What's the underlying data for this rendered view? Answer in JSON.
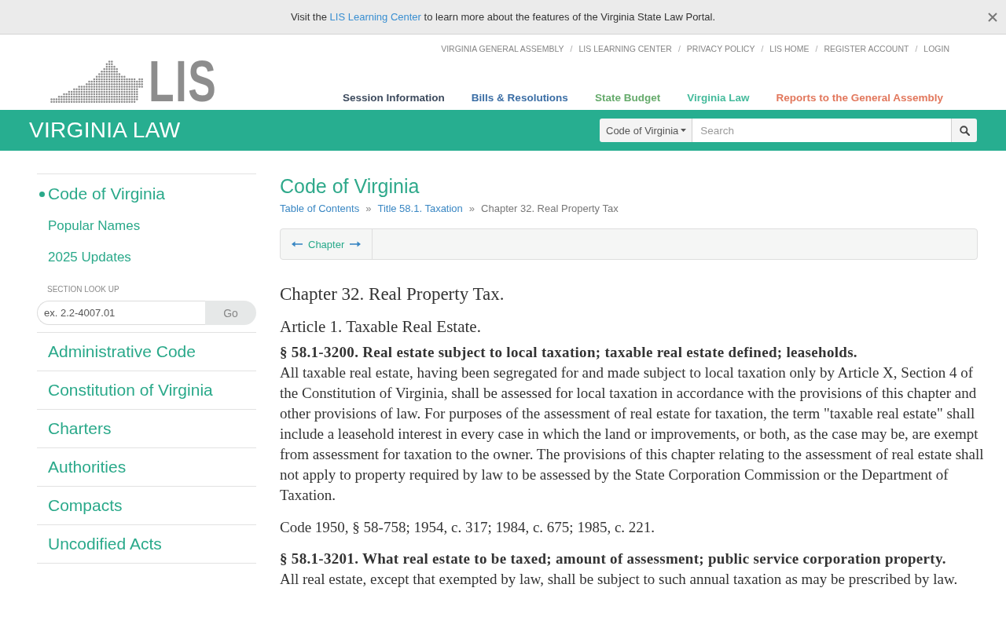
{
  "banner": {
    "text_before": "Visit the",
    "link": "LIS Learning Center",
    "text_after": "to learn more about the features of the Virginia State Law Portal."
  },
  "header": {
    "logo_text": "LIS",
    "top_links": [
      {
        "kind": "link",
        "label": "VIRGINIA GENERAL ASSEMBLY"
      },
      {
        "kind": "separator",
        "label": "/"
      },
      {
        "kind": "link",
        "label": "LIS LEARNING CENTER"
      },
      {
        "kind": "separator",
        "label": "/"
      },
      {
        "kind": "link",
        "label": "PRIVACY POLICY"
      },
      {
        "kind": "separator",
        "label": "/"
      },
      {
        "kind": "link",
        "label": "LIS HOME"
      },
      {
        "kind": "separator",
        "label": "/"
      },
      {
        "kind": "link",
        "label": "REGISTER ACCOUNT"
      },
      {
        "kind": "separator",
        "label": "/"
      },
      {
        "kind": "link",
        "label": "LOGIN"
      }
    ],
    "nav": [
      {
        "label": "Session Information",
        "color": "#3d4b5e"
      },
      {
        "label": "Bills & Resolutions",
        "color": "#3b6ea5"
      },
      {
        "label": "State Budget",
        "color": "#66ab6c"
      },
      {
        "label": "Virginia Law",
        "color": "#45bb9c"
      },
      {
        "label": "Reports to the General Assembly",
        "color": "#e2785d"
      }
    ]
  },
  "law_bar": {
    "title": "VIRGINIA LAW",
    "search": {
      "scope": "Code of Virginia",
      "placeholder": "Search"
    }
  },
  "sidebar": {
    "items": [
      {
        "label": "Code of Virginia",
        "selected": true
      },
      {
        "label": "Popular Names",
        "selected": false
      },
      {
        "label": "2025 Updates",
        "selected": false
      }
    ],
    "lookup": {
      "label": "SECTION LOOK UP",
      "placeholder": "ex. 2.2-4007.01",
      "button": "Go"
    },
    "collections": [
      "Administrative Code",
      "Constitution of Virginia",
      "Charters",
      "Authorities",
      "Compacts",
      "Uncodified Acts"
    ]
  },
  "content": {
    "title": "Code of Virginia",
    "breadcrumb": [
      {
        "kind": "link",
        "label": "Table of Contents"
      },
      {
        "kind": "separator",
        "label": "»"
      },
      {
        "kind": "link",
        "label": "Title 58.1. Taxation"
      },
      {
        "kind": "separator",
        "label": "»"
      },
      {
        "kind": "current",
        "label": "Chapter 32. Real Property Tax"
      }
    ],
    "chapter_nav": {
      "label": "Chapter"
    },
    "chapter": "Chapter 32. Real Property Tax.",
    "article": "Article 1. Taxable Real Estate.",
    "sections": [
      {
        "heading": "§ 58.1-3200. Real estate subject to local taxation; taxable real estate defined; leaseholds.",
        "paragraphs": [
          "All taxable real estate, having been segregated for and made subject to local taxation only by Article X, Section 4 of the Constitution of Virginia, shall be assessed for local taxation in accordance with the provisions of this chapter and other provisions of law. For purposes of the assessment of real estate for taxation, the term \"taxable real estate\" shall include a leasehold interest in every case in which the land or improvements, or both, as the case may be, are exempt from assessment for taxation to the owner. The provisions of this chapter relating to the assessment of real estate shall not apply to property required by law to be assessed by the State Corporation Commission or the Department of Taxation."
        ],
        "history": "Code 1950, § 58-758; 1954, c. 317; 1984, c. 675; 1985, c. 221."
      },
      {
        "heading": "§ 58.1-3201. What real estate to be taxed; amount of assessment; public service corporation property.",
        "paragraphs": [
          "All real estate, except that exempted by law, shall be subject to such annual taxation as may be prescribed by law."
        ]
      }
    ]
  }
}
